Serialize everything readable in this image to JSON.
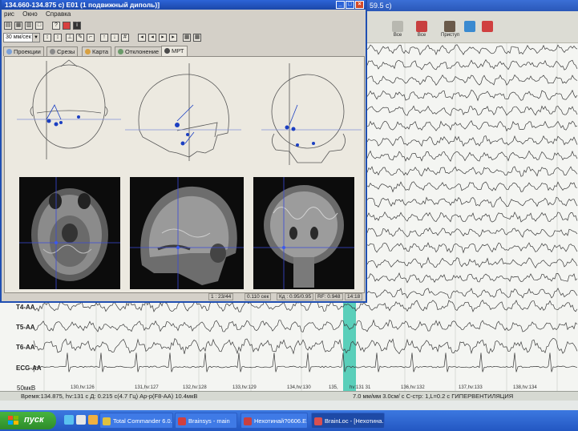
{
  "background_app": {
    "title_fragment": "59.5 с)",
    "toolbar": [
      {
        "label": "Все",
        "icon": "montage-icon",
        "color": "#b8b8b0"
      },
      {
        "label": "Все",
        "icon": "montage-icon",
        "color": "#c84040"
      },
      {
        "label": "Приступ",
        "icon": "seizure-icon",
        "color": "#6a5a4a"
      },
      {
        "label": "",
        "icon": "photo-icon",
        "color": "#3a8ad0"
      },
      {
        "label": "",
        "icon": "info-icon",
        "color": "#d04040"
      }
    ],
    "channels": [
      {
        "label": "T4-AA"
      },
      {
        "label": "T5-AA"
      },
      {
        "label": "T6-AA"
      },
      {
        "label": "ECG-AA"
      }
    ],
    "amplitude_scale": "50мкВ",
    "time_marks": [
      "130,hv:126",
      "131,hv:127",
      "132,hv:128",
      "133,hv:129",
      "134,hv:130",
      "135,",
      "hv:131 31",
      "136,hv:132",
      "137,hv:133",
      "138,hv:134"
    ],
    "marker_color": "#3ec8b0",
    "status_left": "Время:134.875, hv:131 с Д:  0.215 с(4.7 Гц) Ар-р(F8-AA) 10.4мкВ",
    "status_right": "7.0 мм/мм  3.0см/ с  С-стр: 1,L=0.2 с   ГИПЕРВЕНТИЛЯЦИЯ"
  },
  "dipole_window": {
    "title": "134.660-134.875 с) E01 (1 подвижный диполь)]",
    "menu": [
      "рис",
      "Окно",
      "Справка"
    ],
    "speed_select": "30 мм/сек",
    "tabs": [
      {
        "label": "Проекции",
        "icon_color": "#7aa0d8"
      },
      {
        "label": "Срезы",
        "icon_color": "#8a8a8a"
      },
      {
        "label": "Карта",
        "icon_color": "#d8a040"
      },
      {
        "label": "Отклонение",
        "icon_color": "#6a9a6a"
      },
      {
        "label": "МРТ",
        "icon_color": "#4a4a4a"
      }
    ],
    "active_tab": "МРТ",
    "dipole_color": "#1b3fc2",
    "status": {
      "sample": "1 : 23/44",
      "time": "0.110 сек",
      "quality": "Кд : 0.95/0.95",
      "rf": "RF: 0.948",
      "clock": "14:18"
    }
  },
  "taskbar": {
    "start_label": "пуск",
    "tasks": [
      {
        "label": "Total Commander 6.0...",
        "icon_color": "#e0c040"
      },
      {
        "label": "Brainsys - main",
        "icon_color": "#d04040"
      },
      {
        "label": "Нехотинай?0606.E...",
        "icon_color": "#c84040"
      },
      {
        "label": "BrainLoc - [Нехотина...",
        "icon_color": "#d85050"
      }
    ],
    "active_task": "BrainLoc - [Нехотина..."
  }
}
